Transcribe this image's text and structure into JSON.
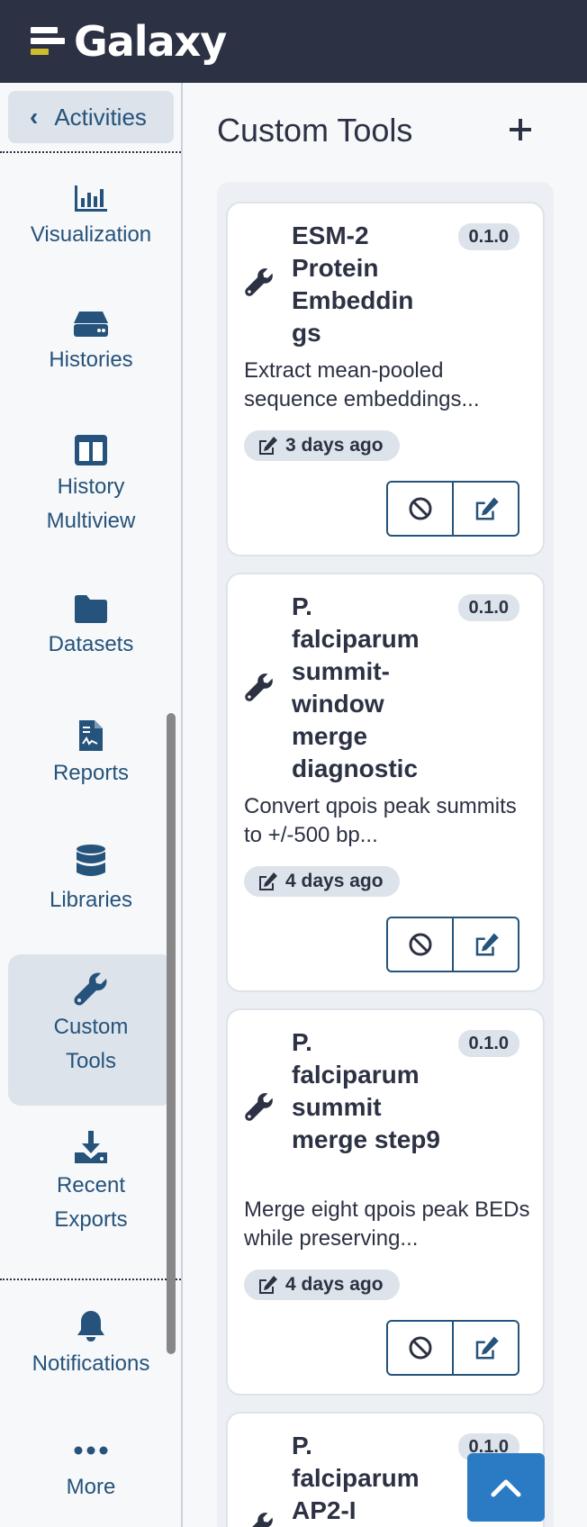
{
  "masthead": {
    "brand": "Galaxy"
  },
  "activity_bar": {
    "back_label": "Activities",
    "items": [
      {
        "label": "Visualization",
        "icon": "chart-bar-icon"
      },
      {
        "label": "Histories",
        "icon": "hdd-icon"
      },
      {
        "label": "History Multiview",
        "icon": "columns-icon"
      },
      {
        "label": "Datasets",
        "icon": "folder-icon"
      },
      {
        "label": "Reports",
        "icon": "file-contract-icon"
      },
      {
        "label": "Libraries",
        "icon": "database-icon"
      },
      {
        "label": "Custom Tools",
        "icon": "wrench-icon",
        "active": true
      },
      {
        "label": "Recent Exports",
        "icon": "file-export-icon"
      },
      {
        "label": "Notifications",
        "icon": "bell-icon"
      },
      {
        "label": "More",
        "icon": "ellipsis-icon"
      }
    ]
  },
  "panel": {
    "title": "Custom Tools",
    "tools": [
      {
        "name": "ESM-2 Protein Embeddin gs",
        "version": "0.1.0",
        "description": "Extract mean-pooled sequence embeddings...",
        "updated": "3 days ago"
      },
      {
        "name": "P. falciparum summit-window merge diagnostic",
        "version": "0.1.0",
        "description": "Convert qpois peak summits to +/-500 bp...",
        "updated": "4 days ago"
      },
      {
        "name": "P. falciparum summit merge step9",
        "version": "0.1.0",
        "description": "Merge eight qpois peak BEDs while preserving...",
        "updated": "4 days ago"
      },
      {
        "name": "P. falciparum AP2-I",
        "version": "0.1.0"
      }
    ]
  },
  "colors": {
    "masthead": "#2c3143",
    "accent": "#25537b",
    "brand_yellow": "#d0bd2a",
    "scroll_top": "#2b7bc4"
  }
}
